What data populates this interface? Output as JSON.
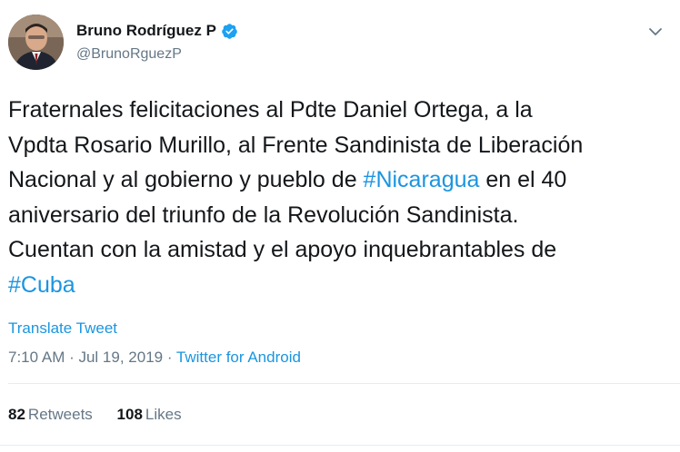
{
  "author": {
    "display_name": "Bruno Rodríguez P",
    "handle": "@BrunoRguezP",
    "verified": true
  },
  "tweet": {
    "lines": [
      [
        {
          "text": "Fraternales felicitaciones al Pdte Daniel Ortega, a la"
        }
      ],
      [
        {
          "text": "Vpdta Rosario Murillo, al Frente Sandinista de Liberación"
        }
      ],
      [
        {
          "text": "Nacional y al gobierno y pueblo de "
        },
        {
          "text": "#Nicaragua",
          "hashtag": true
        },
        {
          "text": " en el 40"
        }
      ],
      [
        {
          "text": "aniversario del triunfo de la Revolución Sandinista."
        }
      ],
      [
        {
          "text": "Cuentan con la amistad y el apoyo inquebrantables de"
        }
      ],
      [
        {
          "text": "#Cuba",
          "hashtag": true
        }
      ]
    ],
    "translate_label": "Translate Tweet",
    "timestamp": "7:10 AM · Jul 19, 2019",
    "separator": " · ",
    "source": "Twitter for Android"
  },
  "stats": {
    "retweets_count": "82",
    "retweets_label": "Retweets",
    "likes_count": "108",
    "likes_label": "Likes"
  },
  "icons": {
    "verified": "verified-badge-icon",
    "more": "chevron-down-icon"
  },
  "colors": {
    "link": "#1b95e0",
    "text": "#14171a",
    "muted": "#657786",
    "verified": "#1da1f2"
  }
}
